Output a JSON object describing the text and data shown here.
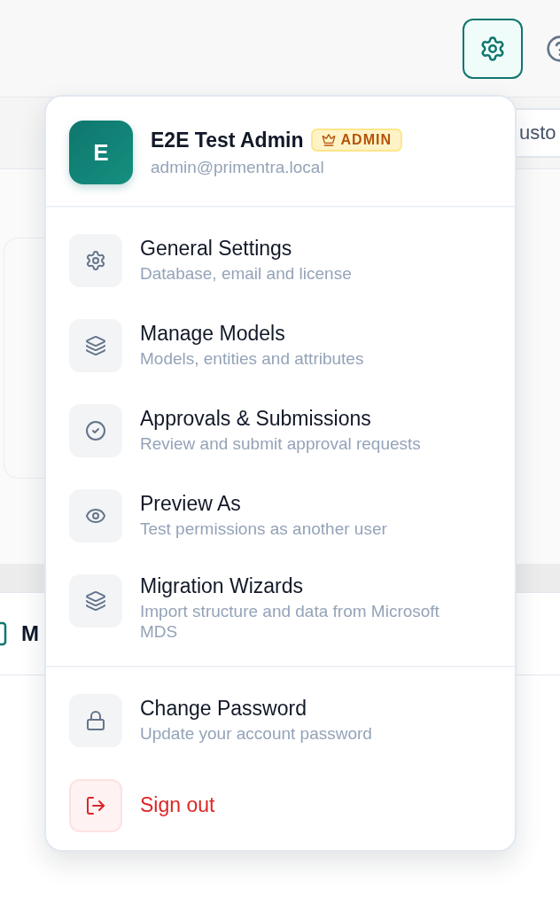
{
  "toolbar": {
    "settings_button": {
      "selected": true
    }
  },
  "search_field": {
    "value": "usto"
  },
  "list_row": {
    "title": "M"
  },
  "menu": {
    "user": {
      "initial": "E",
      "name": "E2E Test Admin",
      "role": "ADMIN",
      "email": "admin@primentra.local"
    },
    "sections": [
      {
        "items": [
          {
            "kind": "normal",
            "title": "General Settings",
            "description": "Database, email and license"
          },
          {
            "kind": "normal",
            "title": "Manage Models",
            "description": "Models, entities and attributes"
          },
          {
            "kind": "normal",
            "title": "Approvals & Submissions",
            "description": "Review and submit approval requests"
          },
          {
            "kind": "normal",
            "title": "Preview As",
            "description": "Test permissions as another user"
          },
          {
            "kind": "normal",
            "title": "Migration Wizards",
            "description": "Import structure and data from Microsoft MDS"
          }
        ]
      },
      {
        "items": [
          {
            "kind": "normal",
            "title": "Change Password",
            "description": "Update your account password"
          },
          {
            "kind": "danger",
            "title": "Sign out"
          }
        ]
      }
    ]
  }
}
